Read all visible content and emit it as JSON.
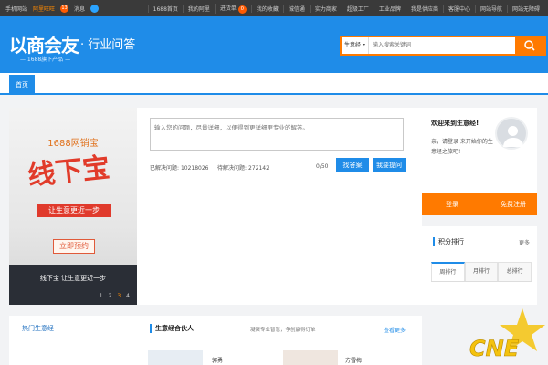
{
  "topbar": {
    "left_items": [
      "手机网站",
      "阿里旺旺",
      "消息"
    ],
    "new_badge": "13",
    "right_items": [
      "1688首页",
      "我的阿里",
      "进货单",
      "我的收藏",
      "诚信通",
      "实力商家",
      "超级工厂",
      "工业品牌",
      "我是供应商",
      "客服中心",
      "网站导航",
      "网站无障碍"
    ],
    "cart_count": "0"
  },
  "header": {
    "logo": "以商会友",
    "logo_suffix": "· 行业问答",
    "slogan": "— 1688旗下产品 —",
    "search_scope": "生意经",
    "search_placeholder": "输入搜索关键词"
  },
  "nav": {
    "tab_home": "首页"
  },
  "banner": {
    "brand": "1688网销宝",
    "headline": "线下宝",
    "ribbon": "让生意更近一步",
    "cta": "立即预约",
    "caption": "线下宝 让生意更近一步",
    "pages": [
      "1",
      "2",
      "3",
      "4"
    ],
    "active_page": "3"
  },
  "ask": {
    "placeholder": "输入您的问题，尽量详细，以便得到更详细更专业的解答。",
    "solved_label": "已解决问题:",
    "solved_count": "10218026",
    "pending_label": "待解决问题:",
    "pending_count": "272142",
    "char_count": "0/50",
    "find_answer": "找答案",
    "ask_question": "我要提问"
  },
  "welcome": {
    "title": "欢迎来到生意经!",
    "text": "亲，请登录 来开始你的生意经之旅吧!",
    "login": "登录",
    "register": "免费注册"
  },
  "rank": {
    "title": "积分排行",
    "more": "更多",
    "tabs": [
      "周排行",
      "月排行",
      "总排行"
    ]
  },
  "hot": {
    "title": "热门生意经"
  },
  "partner": {
    "title": "生意经合伙人",
    "subtitle": "凝聚专业智慧，争创赢得订单",
    "more": "查看更多",
    "names": [
      "郭勇",
      "方雪梅"
    ]
  },
  "watermark": {
    "text": "CNE"
  },
  "colors": {
    "brand_blue": "#1f8ce8",
    "accent_orange": "#ff7a00",
    "topbar": "#3a3a3a"
  }
}
